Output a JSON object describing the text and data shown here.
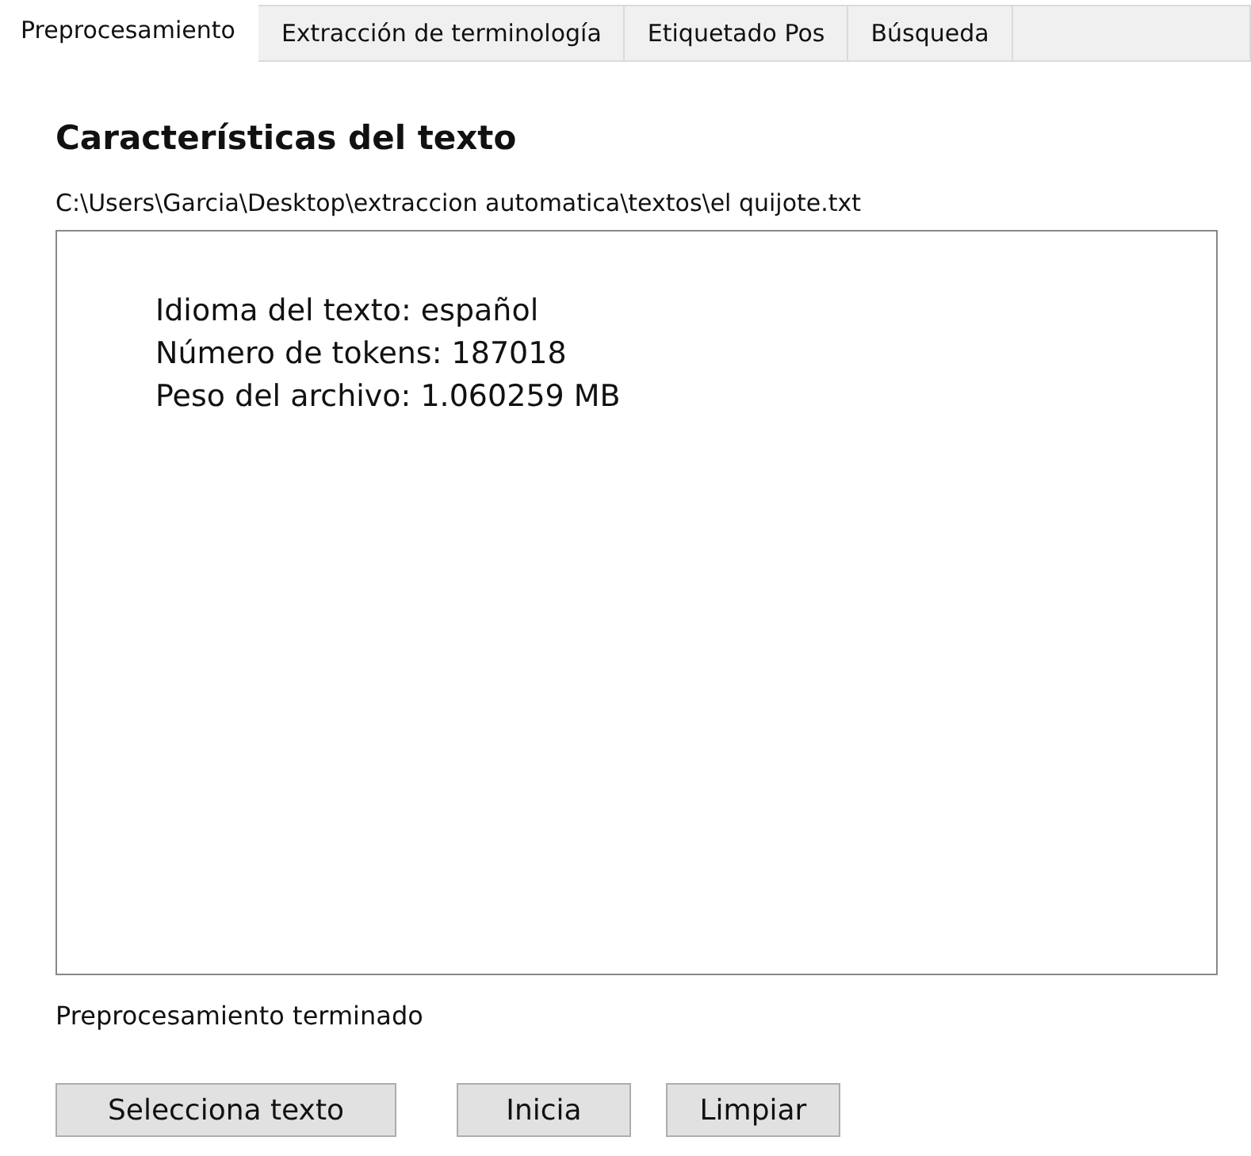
{
  "tabs": [
    {
      "label": "Preprocesamiento",
      "selected": true
    },
    {
      "label": "Extracción de terminología",
      "selected": false
    },
    {
      "label": "Etiquetado Pos",
      "selected": false
    },
    {
      "label": "Búsqueda",
      "selected": false
    }
  ],
  "heading": "Características del texto",
  "file_path": "C:\\Users\\Garcia\\Desktop\\extraccion automatica\\textos\\el quijote.txt",
  "output_lines": [
    "Idioma del texto: español",
    "Número de tokens: 187018",
    "Peso del archivo: 1.060259 MB"
  ],
  "status": "Preprocesamiento terminado",
  "buttons": [
    {
      "label": "Selecciona texto"
    },
    {
      "label": "Inicia"
    },
    {
      "label": "Limpiar"
    }
  ]
}
